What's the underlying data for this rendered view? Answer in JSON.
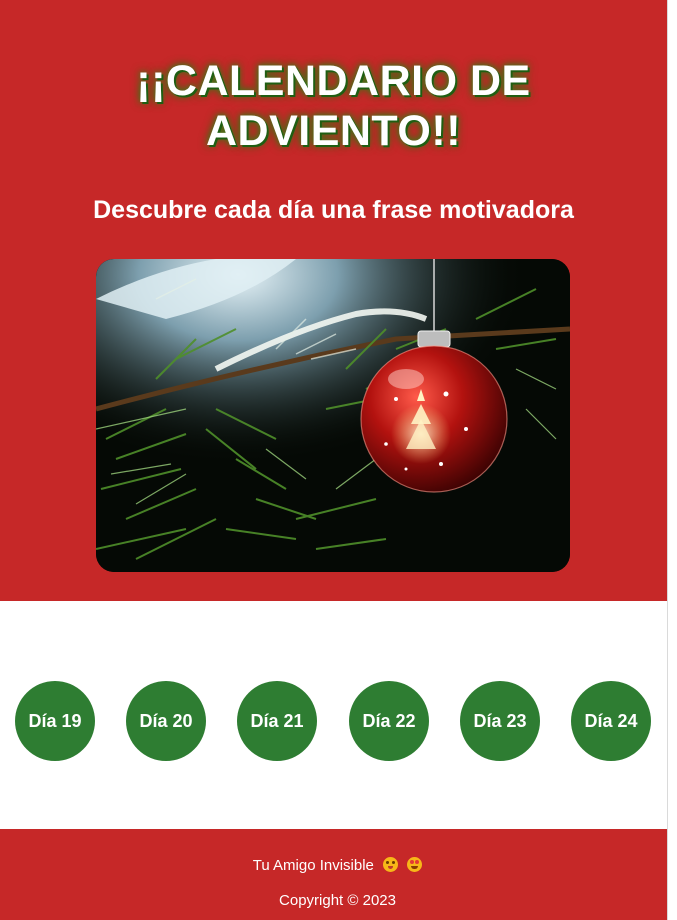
{
  "header": {
    "title_line1": "¡¡CALENDARIO DE",
    "title_line2": "ADVIENTO!!",
    "subtitle": "Descubre cada día una frase motivadora",
    "colors": {
      "background": "#c62828",
      "title_shadow": "#2e6a10"
    }
  },
  "hero_image": {
    "subject": "red christmas bauble on a pine branch"
  },
  "days": [
    {
      "label": "Día 19"
    },
    {
      "label": "Día 20"
    },
    {
      "label": "Día 21"
    },
    {
      "label": "Día 22"
    },
    {
      "label": "Día 23"
    },
    {
      "label": "Día 24"
    }
  ],
  "days_color": "#2e7d32",
  "footer": {
    "credit": "Tu Amigo Invisible",
    "emojis": [
      "grimacing-emoji-icon",
      "heart-eyes-emoji-icon"
    ],
    "copyright": "Copyright © 2023"
  }
}
